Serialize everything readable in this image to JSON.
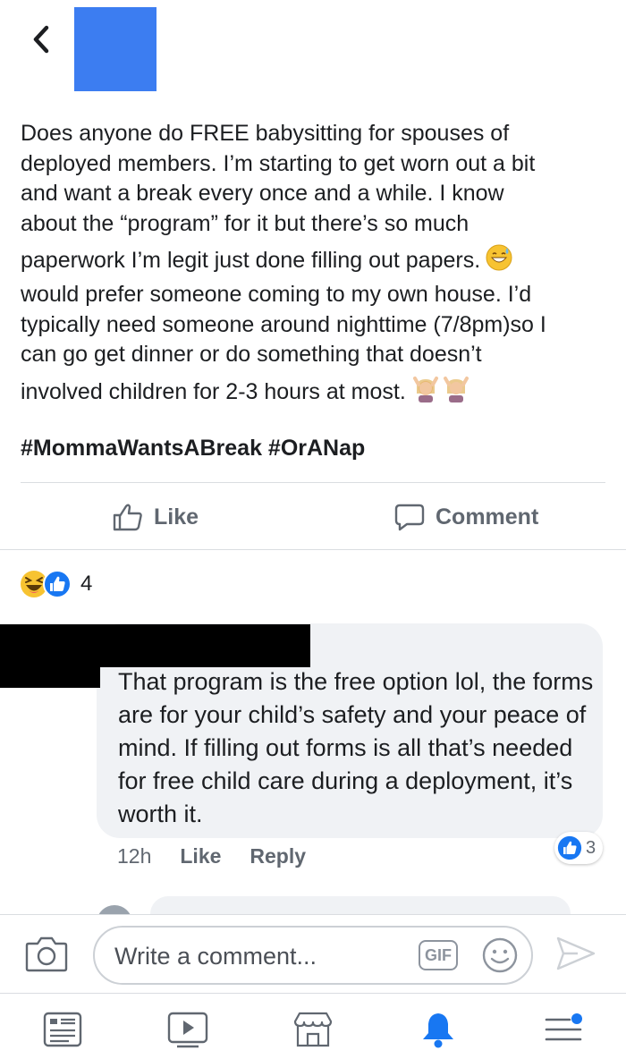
{
  "post": {
    "paragraph_lines": [
      "Does anyone do FREE babysitting for spouses of",
      "deployed members. I’m starting to get worn out a bit",
      "and want a break every once and a while. I know",
      "about the “program” for it but there’s so much",
      "paperwork I’m legit just done filling out papers.",
      "would prefer someone coming to my own house. I’d",
      "typically need someone around nighttime (7/8pm)so I",
      "can go get dinner or do something that doesn’t",
      "involved children for 2-3 hours at most."
    ],
    "hashtags": "#MommaWantsABreak #OrANap"
  },
  "actions": {
    "like_label": "Like",
    "comment_label": "Comment"
  },
  "reactions": {
    "count": "4"
  },
  "comment": {
    "text": "That program is the free option lol, the forms are for your child’s safety and your peace of mind.  If filling out forms is all that’s needed for free child care during a deployment, it’s worth it.",
    "time": "12h",
    "like_label": "Like",
    "reply_label": "Reply",
    "like_count": "3"
  },
  "composer": {
    "placeholder": "Write a comment...",
    "gif_label": "GIF"
  },
  "colors": {
    "accent": "#1877f2",
    "redaction_blue": "#3c7df1",
    "muted": "#606770"
  }
}
